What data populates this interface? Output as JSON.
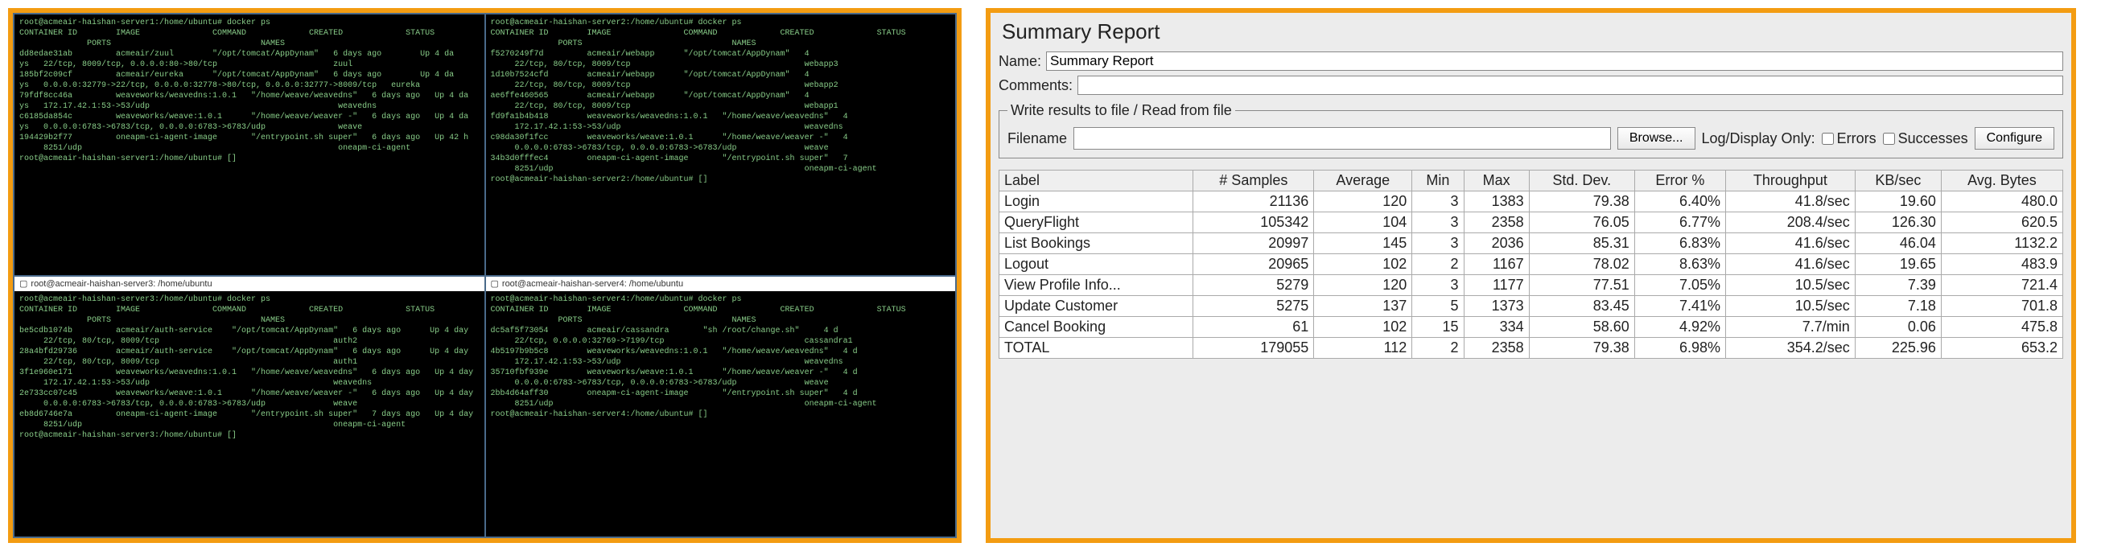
{
  "terminals": [
    {
      "title_visible": false,
      "title": "root@acmeair-haishan-server1: /home/ubuntu",
      "lines": [
        "root@acmeair-haishan-server1:/home/ubuntu# docker ps",
        "CONTAINER ID        IMAGE               COMMAND             CREATED             STATUS",
        "              PORTS                               NAMES",
        "dd8edae31ab         acmeair/zuul        \"/opt/tomcat/AppDynam\"   6 days ago        Up 4 da",
        "ys   22/tcp, 8009/tcp, 0.0.0.0:80->80/tcp                        zuul",
        "185bf2c09cf         acmeair/eureka      \"/opt/tomcat/AppDynam\"   6 days ago        Up 4 da",
        "ys   0.0.0.0:32779->22/tcp, 0.0.0.0:32778->80/tcp, 0.0.0.0:32777->8009/tcp   eureka",
        "79fdf8cc46a         weaveworks/weavedns:1.0.1   \"/home/weave/weavedns\"   6 days ago   Up 4 da",
        "ys   172.17.42.1:53->53/udp                                       weavedns",
        "c6185da854c         weaveworks/weave:1.0.1      \"/home/weave/weaver -\"   6 days ago   Up 4 da",
        "ys   0.0.0.0:6783->6783/tcp, 0.0.0.0:6783->6783/udp               weave",
        "194429b2f77         oneapm-ci-agent-image       \"/entrypoint.sh super\"   6 days ago   Up 42 h",
        "     8251/udp                                                     oneapm-ci-agent",
        "root@acmeair-haishan-server1:/home/ubuntu# []"
      ]
    },
    {
      "title_visible": false,
      "title": "root@acmeair-haishan-server2: /home/ubuntu",
      "lines": [
        "root@acmeair-haishan-server2:/home/ubuntu# docker ps",
        "CONTAINER ID        IMAGE               COMMAND             CREATED             STATUS",
        "              PORTS                               NAMES",
        "f5270249f7d         acmeair/webapp      \"/opt/tomcat/AppDynam\"   4                  ",
        "     22/tcp, 80/tcp, 8009/tcp                                    webapp3",
        "1d10b7524cfd        acmeair/webapp      \"/opt/tomcat/AppDynam\"   4                  ",
        "     22/tcp, 80/tcp, 8009/tcp                                    webapp2",
        "ae6ffe460565        acmeair/webapp      \"/opt/tomcat/AppDynam\"   4                  ",
        "     22/tcp, 80/tcp, 8009/tcp                                    webapp1",
        "fd9fa1b4b418        weaveworks/weavedns:1.0.1   \"/home/weave/weavedns\"   4            ",
        "     172.17.42.1:53->53/udp                                      weavedns",
        "c98da30f1fcc        weaveworks/weave:1.0.1      \"/home/weave/weaver -\"   4            ",
        "     0.0.0.0:6783->6783/tcp, 0.0.0.0:6783->6783/udp              weave",
        "34b3d0fffec4        oneapm-ci-agent-image       \"/entrypoint.sh super\"   7            ",
        "     8251/udp                                                    oneapm-ci-agent",
        "root@acmeair-haishan-server2:/home/ubuntu# []"
      ]
    },
    {
      "title_visible": true,
      "title": "root@acmeair-haishan-server3: /home/ubuntu",
      "lines": [
        "root@acmeair-haishan-server3:/home/ubuntu# docker ps",
        "CONTAINER ID        IMAGE               COMMAND             CREATED             STATUS",
        "              PORTS                               NAMES",
        "be5cdb1074b         acmeair/auth-service    \"/opt/tomcat/AppDynam\"   6 days ago      Up 4 day",
        "     22/tcp, 80/tcp, 8009/tcp                                    auth2",
        "28a4bfd29736        acmeair/auth-service    \"/opt/tomcat/AppDynam\"   6 days ago      Up 4 day",
        "     22/tcp, 80/tcp, 8009/tcp                                    auth1",
        "3f1e960e171         weaveworks/weavedns:1.0.1   \"/home/weave/weavedns\"   6 days ago   Up 4 day",
        "     172.17.42.1:53->53/udp                                      weavedns",
        "2e733cc07c45        weaveworks/weave:1.0.1      \"/home/weave/weaver -\"   6 days ago   Up 4 day",
        "     0.0.0.0:6783->6783/tcp, 0.0.0.0:6783->6783/udp              weave",
        "eb8d6746e7a         oneapm-ci-agent-image       \"/entrypoint.sh super\"   7 days ago   Up 4 day",
        "     8251/udp                                                    oneapm-ci-agent",
        "root@acmeair-haishan-server3:/home/ubuntu# []"
      ]
    },
    {
      "title_visible": true,
      "title": "root@acmeair-haishan-server4: /home/ubuntu",
      "lines": [
        "root@acmeair-haishan-server4:/home/ubuntu# docker ps",
        "CONTAINER ID        IMAGE               COMMAND             CREATED             STATUS",
        "              PORTS                               NAMES",
        "dc5af5f73054        acmeair/cassandra       \"sh /root/change.sh\"     4 d",
        "     22/tcp, 0.0.0.0:32769->7199/tcp                             cassandra1",
        "4b5197b9b5c8        weaveworks/weavedns:1.0.1   \"/home/weave/weavedns\"   4 d",
        "     172.17.42.1:53->53/udp                                      weavedns",
        "35710fbf939e        weaveworks/weave:1.0.1      \"/home/weave/weaver -\"   4 d",
        "     0.0.0.0:6783->6783/tcp, 0.0.0.0:6783->6783/udp              weave",
        "2bb4d64aff30        oneapm-ci-agent-image       \"/entrypoint.sh super\"   4 d",
        "     8251/udp                                                    oneapm-ci-agent",
        "root@acmeair-haishan-server4:/home/ubuntu# []"
      ]
    }
  ],
  "summary": {
    "title": "Summary Report",
    "name_label": "Name:",
    "name_value": "Summary Report",
    "comments_label": "Comments:",
    "comments_value": "",
    "fieldset_legend": "Write results to file / Read from file",
    "filename_label": "Filename",
    "filename_value": "",
    "browse_label": "Browse...",
    "logdisplay_label": "Log/Display Only:",
    "errors_label": "Errors",
    "successes_label": "Successes",
    "configure_label": "Configure",
    "columns": [
      "Label",
      "# Samples",
      "Average",
      "Min",
      "Max",
      "Std. Dev.",
      "Error %",
      "Throughput",
      "KB/sec",
      "Avg. Bytes"
    ],
    "rows": [
      [
        "Login",
        "21136",
        "120",
        "3",
        "1383",
        "79.38",
        "6.40%",
        "41.8/sec",
        "19.60",
        "480.0"
      ],
      [
        "QueryFlight",
        "105342",
        "104",
        "3",
        "2358",
        "76.05",
        "6.77%",
        "208.4/sec",
        "126.30",
        "620.5"
      ],
      [
        "List Bookings",
        "20997",
        "145",
        "3",
        "2036",
        "85.31",
        "6.83%",
        "41.6/sec",
        "46.04",
        "1132.2"
      ],
      [
        "Logout",
        "20965",
        "102",
        "2",
        "1167",
        "78.02",
        "8.63%",
        "41.6/sec",
        "19.65",
        "483.9"
      ],
      [
        "View Profile Info...",
        "5279",
        "120",
        "3",
        "1177",
        "77.51",
        "7.05%",
        "10.5/sec",
        "7.39",
        "721.4"
      ],
      [
        "Update Customer",
        "5275",
        "137",
        "5",
        "1373",
        "83.45",
        "7.41%",
        "10.5/sec",
        "7.18",
        "701.8"
      ],
      [
        "Cancel Booking",
        "61",
        "102",
        "15",
        "334",
        "58.60",
        "4.92%",
        "7.7/min",
        "0.06",
        "475.8"
      ],
      [
        "TOTAL",
        "179055",
        "112",
        "2",
        "2358",
        "79.38",
        "6.98%",
        "354.2/sec",
        "225.96",
        "653.2"
      ]
    ]
  }
}
